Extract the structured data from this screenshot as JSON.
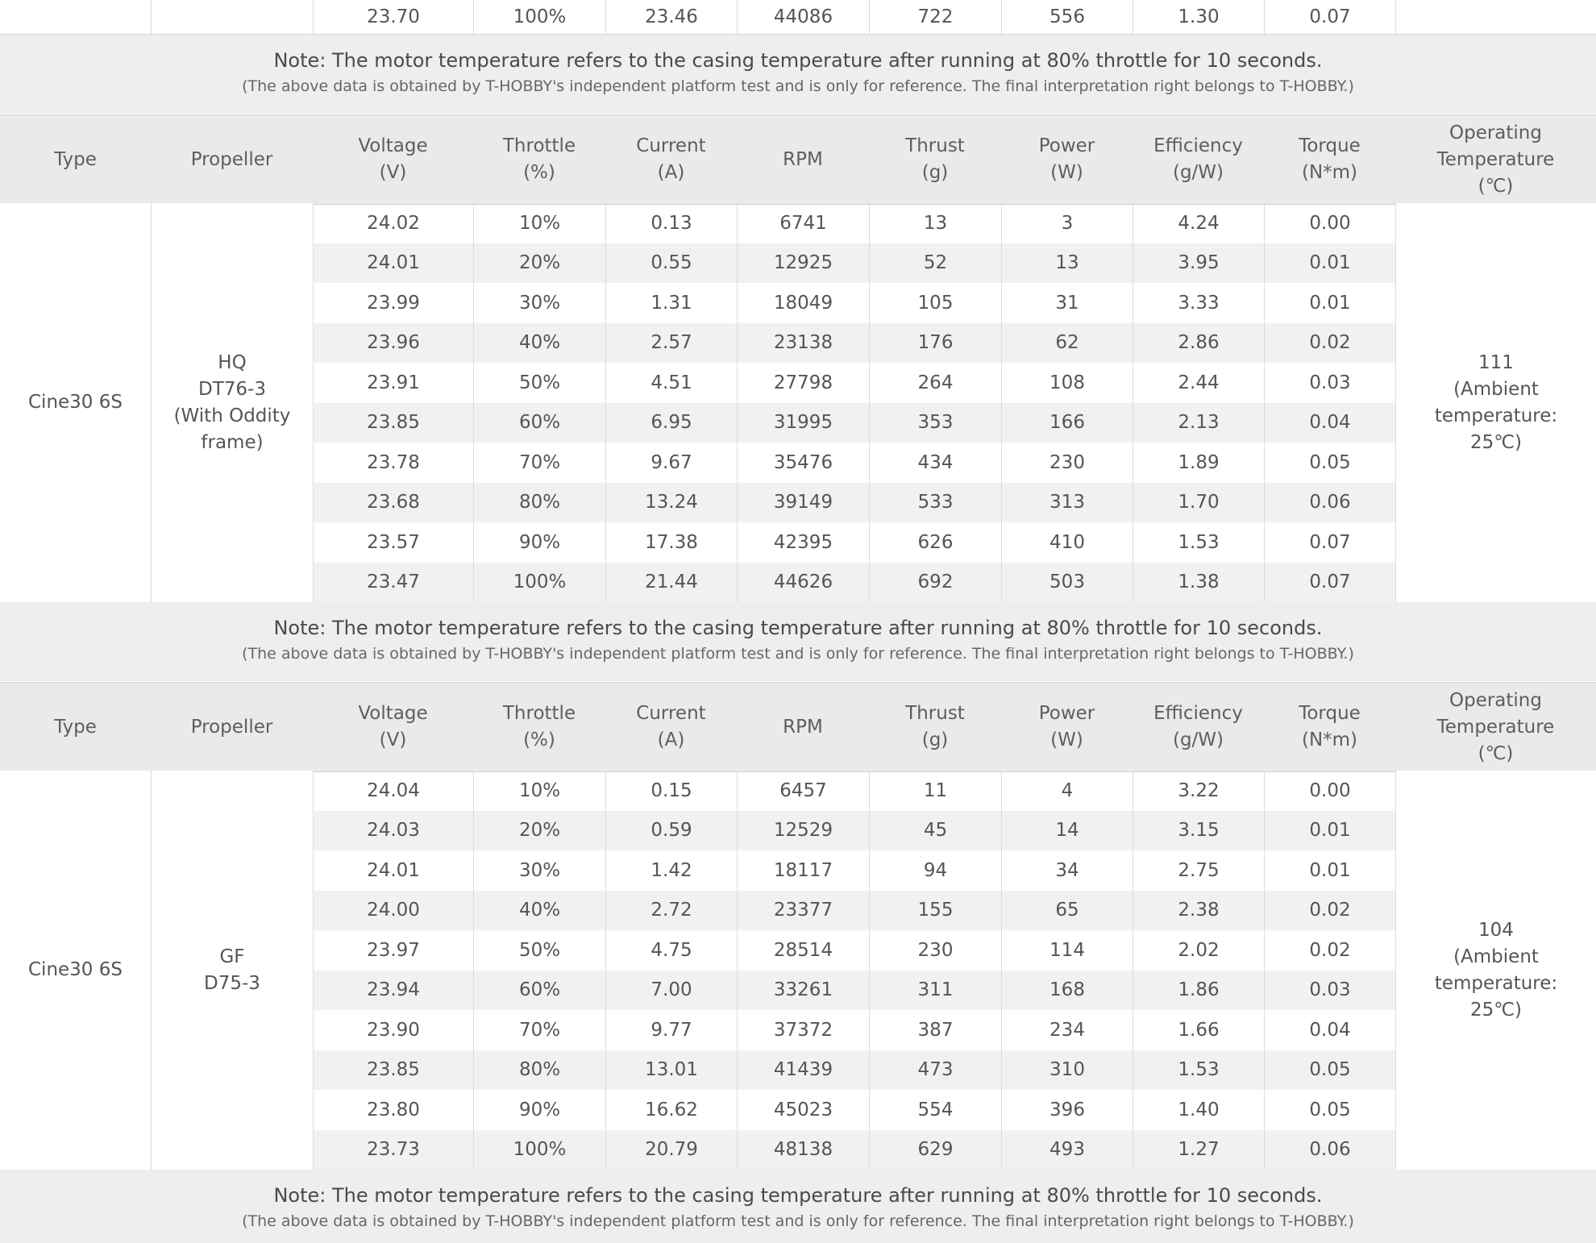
{
  "headers": [
    [
      "Type"
    ],
    [
      "Propeller"
    ],
    [
      "Voltage",
      "(V)"
    ],
    [
      "Throttle",
      "(%)"
    ],
    [
      "Current",
      "(A)"
    ],
    [
      "RPM"
    ],
    [
      "Thrust",
      "(g)"
    ],
    [
      "Power",
      "(W)"
    ],
    [
      "Efficiency",
      "(g/W)"
    ],
    [
      "Torque",
      "(N*m)"
    ],
    [
      "Operating",
      "Temperature",
      "(℃)"
    ]
  ],
  "top_partial_row": [
    "23.70",
    "100%",
    "23.46",
    "44086",
    "722",
    "556",
    "1.30",
    "0.07"
  ],
  "note": {
    "main": "Note: The motor temperature refers to the casing temperature after running at 80% throttle for 10 seconds.",
    "sub": "(The above data is obtained by T-HOBBY's independent platform test and is only for reference. The final interpretation right belongs to T-HOBBY.)"
  },
  "tables": [
    {
      "type": "Cine30 6S",
      "propeller": [
        "HQ",
        "DT76-3",
        "(With Oddity",
        "frame)"
      ],
      "temperature": [
        "111",
        "(Ambient",
        "temperature:",
        "25℃)"
      ],
      "rows": [
        [
          "24.02",
          "10%",
          "0.13",
          "6741",
          "13",
          "3",
          "4.24",
          "0.00"
        ],
        [
          "24.01",
          "20%",
          "0.55",
          "12925",
          "52",
          "13",
          "3.95",
          "0.01"
        ],
        [
          "23.99",
          "30%",
          "1.31",
          "18049",
          "105",
          "31",
          "3.33",
          "0.01"
        ],
        [
          "23.96",
          "40%",
          "2.57",
          "23138",
          "176",
          "62",
          "2.86",
          "0.02"
        ],
        [
          "23.91",
          "50%",
          "4.51",
          "27798",
          "264",
          "108",
          "2.44",
          "0.03"
        ],
        [
          "23.85",
          "60%",
          "6.95",
          "31995",
          "353",
          "166",
          "2.13",
          "0.04"
        ],
        [
          "23.78",
          "70%",
          "9.67",
          "35476",
          "434",
          "230",
          "1.89",
          "0.05"
        ],
        [
          "23.68",
          "80%",
          "13.24",
          "39149",
          "533",
          "313",
          "1.70",
          "0.06"
        ],
        [
          "23.57",
          "90%",
          "17.38",
          "42395",
          "626",
          "410",
          "1.53",
          "0.07"
        ],
        [
          "23.47",
          "100%",
          "21.44",
          "44626",
          "692",
          "503",
          "1.38",
          "0.07"
        ]
      ]
    },
    {
      "type": "Cine30 6S",
      "propeller": [
        "GF",
        "D75-3"
      ],
      "temperature": [
        "104",
        "(Ambient",
        "temperature:",
        "25℃)"
      ],
      "rows": [
        [
          "24.04",
          "10%",
          "0.15",
          "6457",
          "11",
          "4",
          "3.22",
          "0.00"
        ],
        [
          "24.03",
          "20%",
          "0.59",
          "12529",
          "45",
          "14",
          "3.15",
          "0.01"
        ],
        [
          "24.01",
          "30%",
          "1.42",
          "18117",
          "94",
          "34",
          "2.75",
          "0.01"
        ],
        [
          "24.00",
          "40%",
          "2.72",
          "23377",
          "155",
          "65",
          "2.38",
          "0.02"
        ],
        [
          "23.97",
          "50%",
          "4.75",
          "28514",
          "230",
          "114",
          "2.02",
          "0.02"
        ],
        [
          "23.94",
          "60%",
          "7.00",
          "33261",
          "311",
          "168",
          "1.86",
          "0.03"
        ],
        [
          "23.90",
          "70%",
          "9.77",
          "37372",
          "387",
          "234",
          "1.66",
          "0.04"
        ],
        [
          "23.85",
          "80%",
          "13.01",
          "41439",
          "473",
          "310",
          "1.53",
          "0.05"
        ],
        [
          "23.80",
          "90%",
          "16.62",
          "45023",
          "554",
          "396",
          "1.40",
          "0.05"
        ],
        [
          "23.73",
          "100%",
          "20.79",
          "48138",
          "629",
          "493",
          "1.27",
          "0.06"
        ]
      ]
    }
  ]
}
